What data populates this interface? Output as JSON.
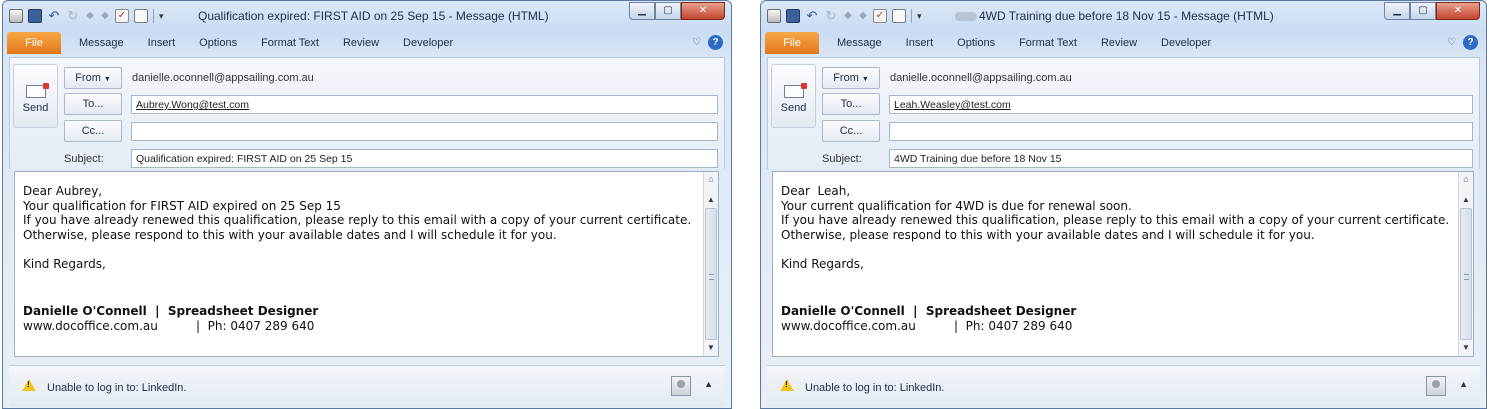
{
  "windows": [
    {
      "title": "Qualification expired: FIRST AID on 25 Sep 15 - Message (HTML)",
      "tabs": [
        "File",
        "Message",
        "Insert",
        "Options",
        "Format Text",
        "Review",
        "Developer"
      ],
      "send_label": "Send",
      "from_label": "From",
      "from_address": "danielle.oconnell@appsailing.com.au",
      "to_label": "To...",
      "to_value": "Aubrey.Wong@test.com",
      "cc_label": "Cc...",
      "cc_value": "",
      "subject_label": "Subject:",
      "subject_value": "Qualification expired: FIRST AID on 25 Sep 15",
      "body": {
        "greeting": "Dear Aubrey,",
        "line1": "Your qualification for FIRST AID expired on 25 Sep 15",
        "line2": "If you have already renewed this qualification, please reply to this email with a copy of your current certificate.",
        "line3": "Otherwise, please respond to this with your available dates and I will schedule it for you.",
        "closing": "Kind Regards,",
        "signature": "Danielle O'Connell  |  Spreadsheet Designer",
        "contact": "www.docoffice.com.au          |  Ph: 0407 289 640"
      },
      "social_message": "Unable to log in to: LinkedIn."
    },
    {
      "title": "4WD Training due before 18 Nov 15 - Message (HTML)",
      "tabs": [
        "File",
        "Message",
        "Insert",
        "Options",
        "Format Text",
        "Review",
        "Developer"
      ],
      "send_label": "Send",
      "from_label": "From",
      "from_address": "danielle.oconnell@appsailing.com.au",
      "to_label": "To...",
      "to_value": "Leah.Weasley@test.com",
      "cc_label": "Cc...",
      "cc_value": "",
      "subject_label": "Subject:",
      "subject_value": "4WD Training due before 18 Nov 15",
      "body": {
        "greeting": "Dear  Leah,",
        "line1": "Your current qualification for 4WD is due for renewal soon.",
        "line2": "If you have already renewed this qualification, please reply to this email with a copy of your current certificate.",
        "line3": "Otherwise, please respond to this with your available dates and I will schedule it for you.",
        "closing": "Kind Regards,",
        "signature": "Danielle O'Connell  |  Spreadsheet Designer",
        "contact": "www.docoffice.com.au          |  Ph: 0407 289 640"
      },
      "social_message": "Unable to log in to: LinkedIn."
    }
  ]
}
